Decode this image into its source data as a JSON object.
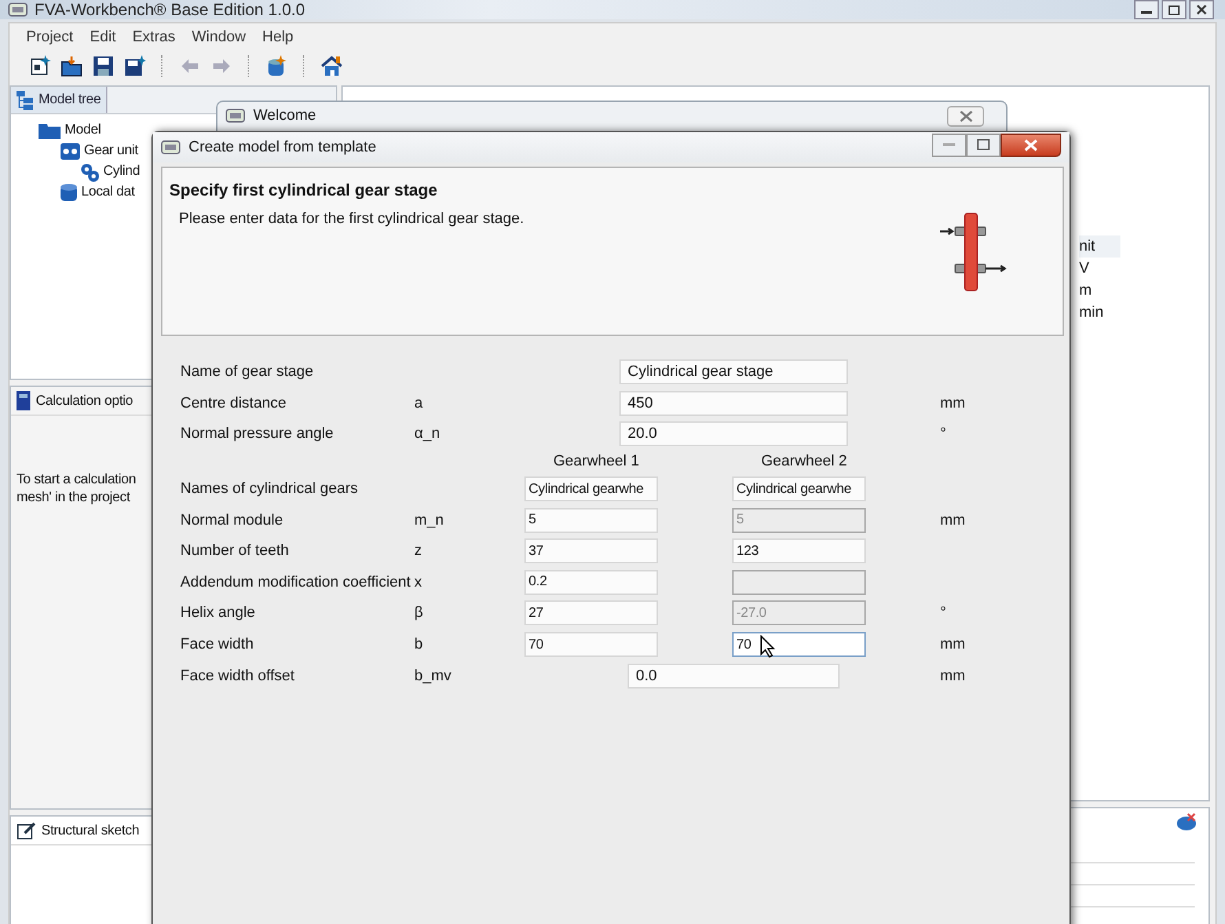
{
  "app": {
    "title": "FVA-Workbench® Base Edition 1.0.0",
    "menu": [
      "Project",
      "Edit",
      "Extras",
      "Window",
      "Help"
    ],
    "model_tree": {
      "tab": "Model tree",
      "items": [
        {
          "label": "Model",
          "kind": "folder",
          "children": [
            {
              "label": "Gear unit",
              "kind": "unit",
              "children": [
                {
                  "label": "Cylind",
                  "kind": "gears"
                }
              ]
            },
            {
              "label": "Local dat",
              "kind": "database"
            }
          ]
        }
      ]
    },
    "calculation": {
      "title": "Calculation optio",
      "text": [
        "To start a calculation",
        "mesh' in the project"
      ]
    },
    "sketch": {
      "title": "Structural sketch"
    },
    "side_table": [
      "nit",
      "V",
      "m",
      "min"
    ]
  },
  "welcome": {
    "title": "Welcome"
  },
  "dialog": {
    "title": "Create model from template",
    "heading": "Specify first cylindrical gear stage",
    "subtitle": "Please enter data for the first cylindrical gear stage.",
    "rows": [
      {
        "kind": "single",
        "label": "Name of gear stage",
        "value": "Cylindrical gear stage"
      },
      {
        "kind": "single",
        "label": "Centre distance",
        "symbol": "a",
        "value": "450",
        "unit": "mm"
      },
      {
        "kind": "single",
        "label": "Normal pressure angle",
        "symbol": "α_n",
        "value": "20.0",
        "unit": "°"
      },
      {
        "kind": "columns",
        "columns": [
          "Gearwheel 1",
          "Gearwheel 2"
        ]
      },
      {
        "kind": "pair",
        "label": "Names of cylindrical gears",
        "fields": [
          {
            "value": "Cylindrical gearwhe",
            "disabled": false,
            "focused": false
          },
          {
            "value": "Cylindrical gearwhe",
            "disabled": false,
            "focused": false
          }
        ]
      },
      {
        "kind": "pair",
        "label": "Normal module",
        "symbol": "m_n",
        "unit": "mm",
        "fields": [
          {
            "value": "5",
            "disabled": false,
            "focused": false
          },
          {
            "value": "5",
            "disabled": true,
            "focused": false
          }
        ]
      },
      {
        "kind": "pair",
        "label": "Number of teeth",
        "symbol": "z",
        "fields": [
          {
            "value": "37",
            "disabled": false,
            "focused": false
          },
          {
            "value": "123",
            "disabled": false,
            "focused": false
          }
        ]
      },
      {
        "kind": "pair",
        "label": "Addendum modification coefficient",
        "symbol": "x",
        "fields": [
          {
            "value": "0.2",
            "disabled": false,
            "focused": false
          },
          {
            "disabled": true,
            "focused": false
          }
        ]
      },
      {
        "kind": "pair",
        "label": "Helix angle",
        "symbol": "β",
        "unit": "°",
        "fields": [
          {
            "value": "27",
            "disabled": false,
            "focused": false
          },
          {
            "value": "-27.0",
            "disabled": true,
            "focused": false
          }
        ]
      },
      {
        "kind": "pair",
        "label": "Face width",
        "symbol": "b",
        "unit": "mm",
        "fields": [
          {
            "value": "70",
            "disabled": false,
            "focused": false
          },
          {
            "value": "70",
            "disabled": false,
            "focused": true
          }
        ]
      },
      {
        "kind": "centered",
        "label": "Face width offset",
        "symbol": "b_mv",
        "value": "0.0",
        "unit": "mm"
      }
    ]
  }
}
